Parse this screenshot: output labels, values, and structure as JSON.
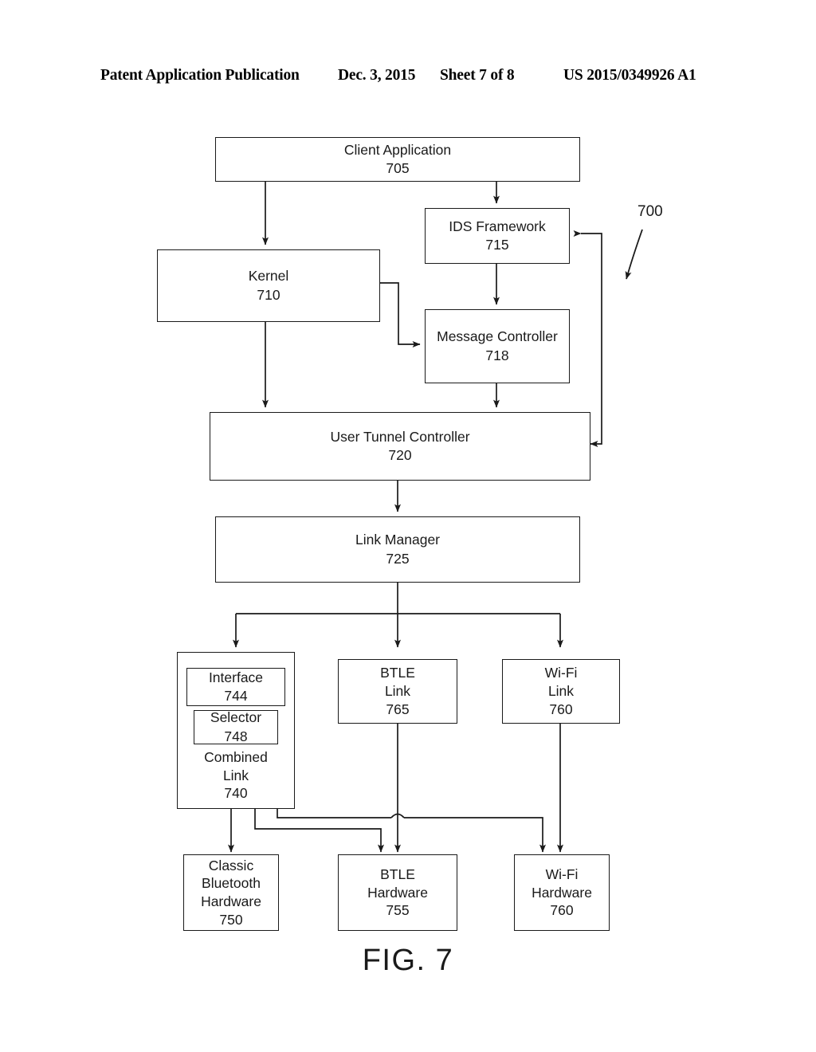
{
  "header": {
    "publication": "Patent Application Publication",
    "date": "Dec. 3, 2015",
    "sheet": "Sheet 7 of 8",
    "publication_number": "US 2015/0349926 A1"
  },
  "figure": {
    "caption": "FIG. 7",
    "diagram_reference": "700"
  },
  "nodes": {
    "client_application": {
      "label": "Client Application",
      "ref": "705"
    },
    "ids_framework": {
      "label": "IDS Framework",
      "ref": "715"
    },
    "kernel": {
      "label": "Kernel",
      "ref": "710"
    },
    "message_controller": {
      "label": "Message Controller",
      "ref": "718"
    },
    "user_tunnel_controller": {
      "label": "User Tunnel Controller",
      "ref": "720"
    },
    "link_manager": {
      "label": "Link Manager",
      "ref": "725"
    },
    "interface": {
      "label": "Interface",
      "ref": "744"
    },
    "selector": {
      "label": "Selector",
      "ref": "748"
    },
    "combined_link": {
      "label": "Combined\nLink",
      "ref": "740"
    },
    "btle_link": {
      "label": "BTLE\nLink",
      "ref": "765"
    },
    "wifi_link": {
      "label": "Wi-Fi\nLink",
      "ref": "760"
    },
    "classic_bluetooth_hardware": {
      "label": "Classic\nBluetooth\nHardware",
      "ref": "750"
    },
    "btle_hardware": {
      "label": "BTLE\nHardware",
      "ref": "755"
    },
    "wifi_hardware": {
      "label": "Wi-Fi\nHardware",
      "ref": "760"
    }
  },
  "connections": [
    {
      "from": "client_application",
      "to": "kernel",
      "type": "bidirectional"
    },
    {
      "from": "client_application",
      "to": "ids_framework",
      "type": "bidirectional"
    },
    {
      "from": "ids_framework",
      "to": "message_controller",
      "type": "bidirectional"
    },
    {
      "from": "kernel",
      "to": "message_controller",
      "type": "bidirectional"
    },
    {
      "from": "kernel",
      "to": "user_tunnel_controller",
      "type": "bidirectional"
    },
    {
      "from": "message_controller",
      "to": "user_tunnel_controller",
      "type": "bidirectional"
    },
    {
      "from": "user_tunnel_controller",
      "to": "ids_framework",
      "type": "bidirectional"
    },
    {
      "from": "user_tunnel_controller",
      "to": "link_manager",
      "type": "bidirectional"
    },
    {
      "from": "link_manager",
      "to": "combined_link",
      "type": "directed"
    },
    {
      "from": "link_manager",
      "to": "btle_link",
      "type": "bidirectional"
    },
    {
      "from": "link_manager",
      "to": "wifi_link",
      "type": "directed"
    },
    {
      "from": "btle_link",
      "to": "btle_hardware",
      "type": "bidirectional"
    },
    {
      "from": "wifi_link",
      "to": "wifi_hardware",
      "type": "bidirectional"
    },
    {
      "from": "combined_link",
      "to": "classic_bluetooth_hardware",
      "type": "directed"
    },
    {
      "from": "combined_link",
      "to": "btle_hardware",
      "type": "directed"
    },
    {
      "from": "combined_link",
      "to": "wifi_hardware",
      "type": "directed"
    }
  ],
  "style": {
    "line_color": "#1a1a1a",
    "background": "#ffffff"
  }
}
